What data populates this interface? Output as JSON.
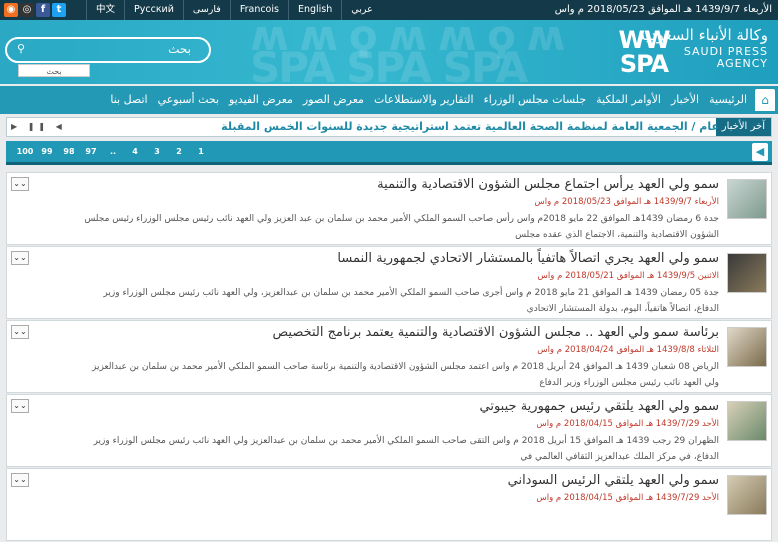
{
  "topbar": {
    "date": "الأربعاء 1439/9/7 هـ الموافق 2018/05/23 م واس",
    "languages": [
      "中文",
      "Русский",
      "فارسی",
      "Francois",
      "English",
      "عربي"
    ]
  },
  "header": {
    "logo_mark": "WW SPA",
    "logo_ar": "وكالة الأنباء السعودية",
    "logo_en_line1": "SAUDI PRESS",
    "logo_en_line2": "AGENCY",
    "search_placeholder": "بحث",
    "search_button": "بحث"
  },
  "nav": {
    "home_icon": "home-icon",
    "items": [
      "الرئيسية",
      "الأخبار",
      "الأوامر الملكية",
      "جلسات مجلس الوزراء",
      "التقارير والاستطلاعات",
      "معرض الصور",
      "معرض الفيديو",
      "بحث أسبوعي",
      "اتصل بنا"
    ]
  },
  "ticker": {
    "label": "آخر الأخبار",
    "text": "عام / الجمعية العامة لمنظمة الصحة العالمية تعتمد استراتيجية جديدة للسنوات الخمس المقبلة"
  },
  "pager": {
    "pages": [
      "100",
      "99",
      "98",
      "97",
      "..",
      "4",
      "3",
      "2",
      "1"
    ]
  },
  "news": [
    {
      "title": "سمو ولي العهد يرأس اجتماع مجلس الشؤون الاقتصادية والتنمية",
      "date": "الأربعاء 1439/9/7 هـ الموافق 2018/05/23 م واس",
      "body": "جدة 6 رمضان 1439هـ الموافق 22 مايو 2018م واس رأس صاحب السمو الملكي الأمير محمد بن سلمان بن عبد العزيز ولي العهد نائب رئيس مجلس الوزراء رئيس مجلس الشؤون الاقتصادية والتنمية، الاجتماع الذي عقده مجلس"
    },
    {
      "title": "سمو ولي العهد يجري اتصالاً هاتفياً بالمستشار الاتحادي لجمهورية النمسا",
      "date": "الاثنين 1439/9/5 هـ الموافق 2018/05/21 م واس",
      "body": "جدة 05 رمضان 1439 هـ الموافق 21 مايو 2018 م واس أجرى صاحب السمو الملكي الأمير محمد بن سلمان بن عبدالعزيز، ولي العهد نائب رئيس مجلس الوزراء وزير الدفاع، اتصالاً هاتفياً، اليوم، بدولة المستشار الاتحادي"
    },
    {
      "title": "برئاسة سمو ولي العهد .. مجلس الشؤون الاقتصادية والتنمية يعتمد برنامج التخصيص",
      "date": "الثلاثاء 1439/8/8 هـ الموافق 2018/04/24 م واس",
      "body": "الرياض 08 شعبان 1439 هـ الموافق 24 أبريل 2018 م واس اعتمد مجلس الشؤون الاقتصادية والتنمية برئاسة صاحب السمو الملكي الأمير محمد بن سلمان بن عبدالعزيز ولي العهد نائب رئيس مجلس الوزراء وزير الدفاع"
    },
    {
      "title": "سمو ولي العهد يلتقي رئيس جمهورية جيبوتي",
      "date": "الأحد 1439/7/29 هـ الموافق 2018/04/15 م واس",
      "body": "الظهران 29 رجب 1439 هـ الموافق 15 أبريل 2018 م واس التقى صاحب السمو الملكي الأمير محمد بن سلمان بن عبدالعزيز ولي العهد نائب رئيس مجلس الوزراء وزير الدفاع، في مركز الملك عبدالعزيز الثقافي العالمي في"
    },
    {
      "title": "سمو ولي العهد يلتقي الرئيس السوداني",
      "date": "الأحد 1439/7/29 هـ الموافق 2018/04/15 م واس",
      "body": ""
    }
  ]
}
